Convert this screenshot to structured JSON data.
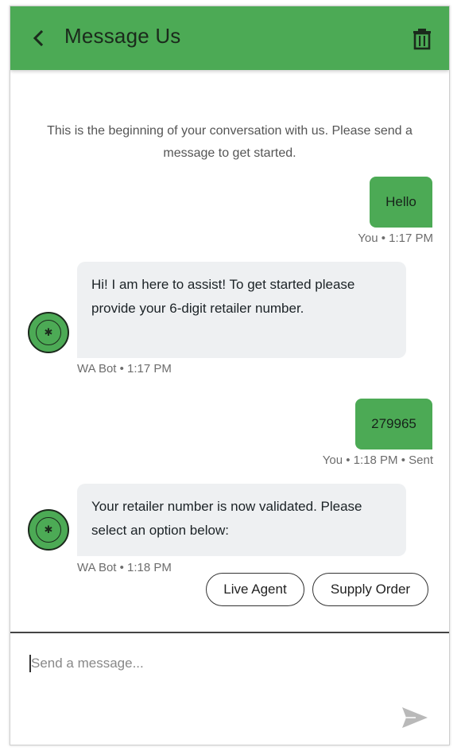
{
  "header": {
    "title": "Message Us",
    "back_icon": "chevron-left-icon",
    "delete_icon": "trash-icon",
    "color": "#4caa55"
  },
  "intro_text": "This is the beginning of your conversation with us. Please send a message to get started.",
  "messages": [
    {
      "direction": "outgoing",
      "text": "Hello",
      "meta": "You • 1:17 PM"
    },
    {
      "direction": "incoming",
      "text": "Hi! I am here to assist! To get started please provide your 6-digit retailer number.",
      "meta": "WA Bot • 1:17 PM"
    },
    {
      "direction": "outgoing",
      "text": "279965",
      "meta": "You • 1:18 PM • Sent"
    },
    {
      "direction": "incoming",
      "text": "Your retailer number is now validated. Please select an option below:",
      "meta": "WA Bot • 1:18 PM"
    }
  ],
  "quick_replies": [
    "Live Agent",
    "Supply Order"
  ],
  "composer": {
    "placeholder": "Send a message...",
    "send_icon": "send-icon"
  },
  "colors": {
    "accent": "#4caa55",
    "incoming_bubble": "#eef0f2"
  }
}
